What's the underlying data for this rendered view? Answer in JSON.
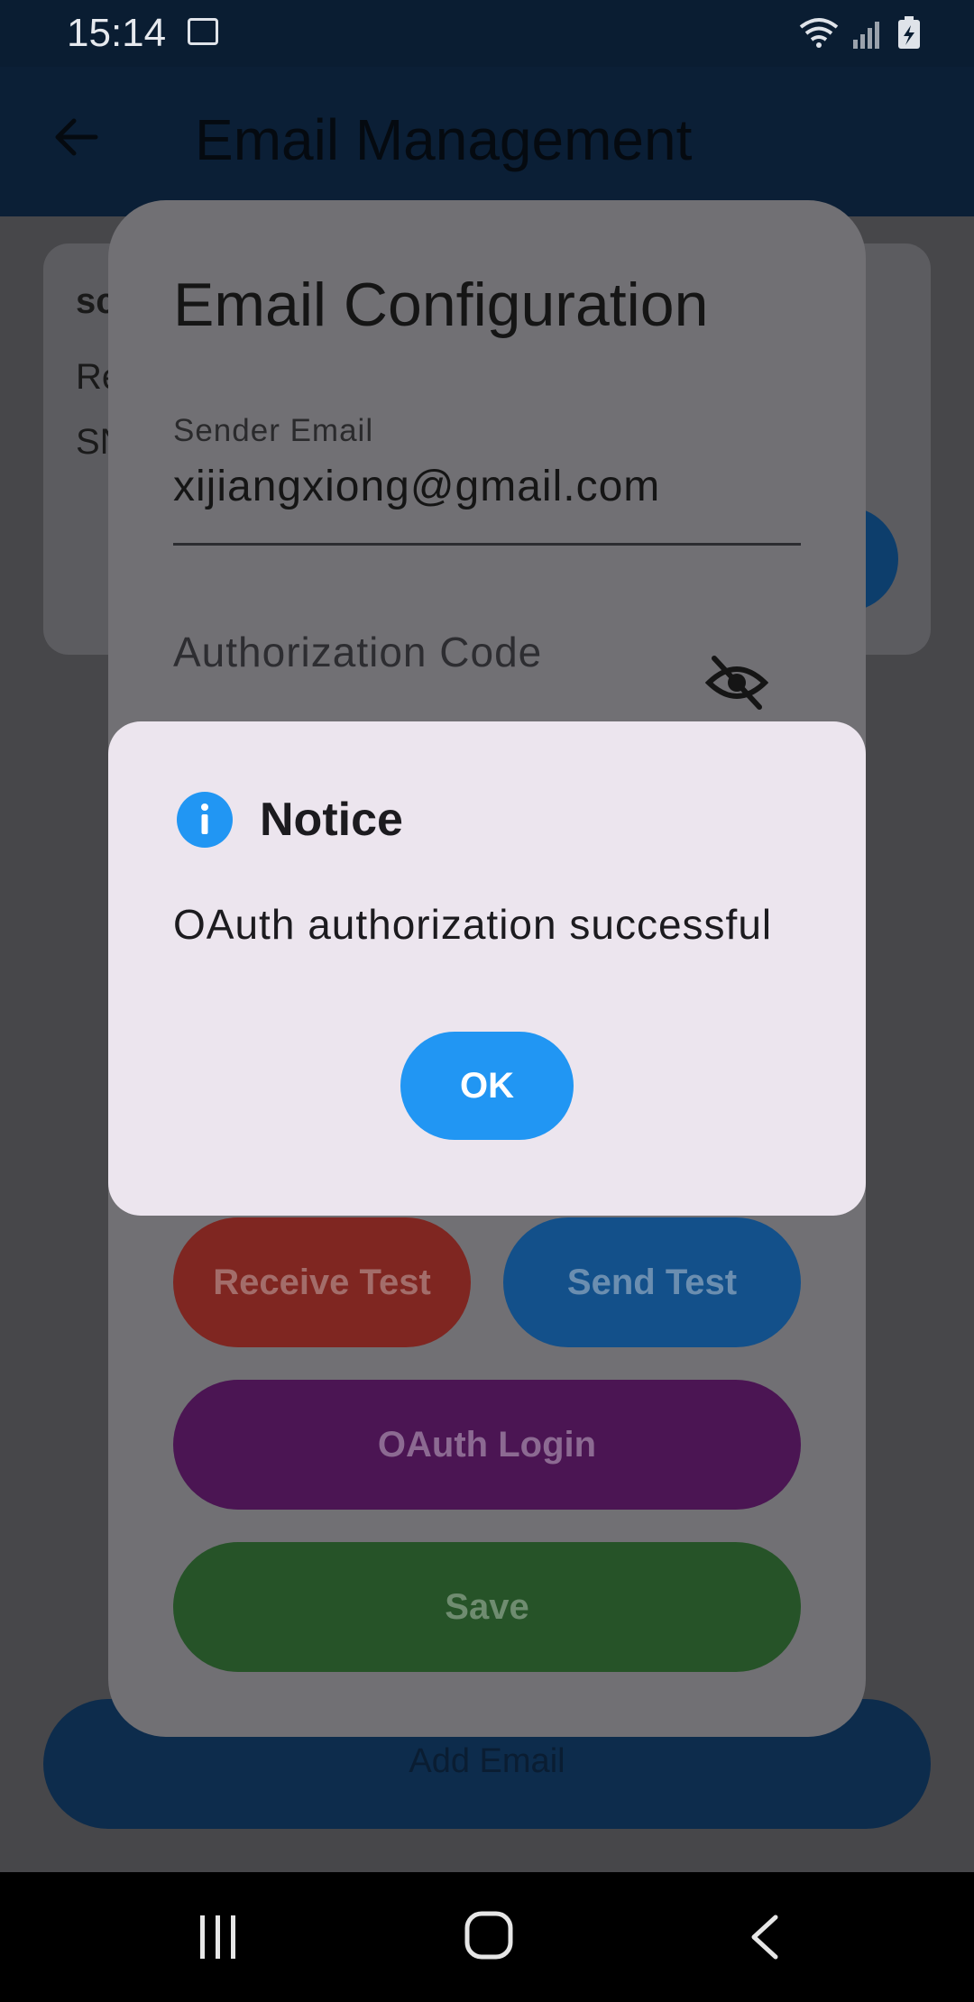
{
  "status_bar": {
    "time": "15:14"
  },
  "app_bar": {
    "title": "Email Management"
  },
  "background_card": {
    "line1": "sc",
    "line2": "Re",
    "line3": "SN"
  },
  "add_email_label": "Add Email",
  "email_config": {
    "title": "Email Configuration",
    "sender_email_label": "Sender Email",
    "sender_email_value": "xijiangxiong@gmail.com",
    "auth_code_label": "Authorization Code",
    "receive_test_label": "Receive Test",
    "send_test_label": "Send Test",
    "oauth_login_label": "OAuth Login",
    "save_label": "Save"
  },
  "dialog": {
    "title": "Notice",
    "message": "OAuth authorization successful",
    "ok_label": "OK"
  },
  "colors": {
    "primary": "#2196f3",
    "receive": "#c62828",
    "send": "#1e88e5",
    "oauth": "#7b1fa2",
    "save": "#388e3c"
  }
}
